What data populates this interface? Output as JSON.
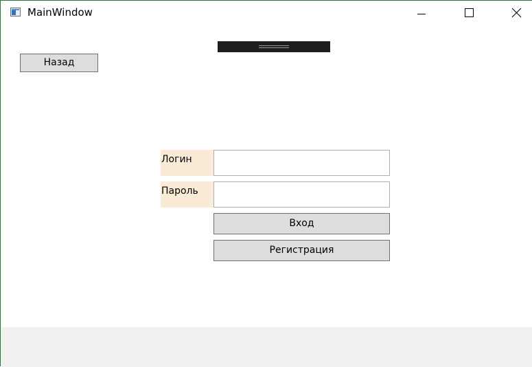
{
  "window": {
    "title": "MainWindow",
    "controls": {
      "minimize_icon": "minimize-icon",
      "maximize_icon": "maximize-icon",
      "close_icon": "close-icon"
    }
  },
  "toolbar": {
    "back_label": "Назад"
  },
  "form": {
    "login_label": "Логин",
    "password_label": "Пароль",
    "login_value": "",
    "password_value": "",
    "login_button": "Вход",
    "register_button": "Регистрация"
  },
  "colors": {
    "label_background": "#faebd7",
    "button_background": "#dddddd",
    "window_border": "#1e7b3a"
  }
}
